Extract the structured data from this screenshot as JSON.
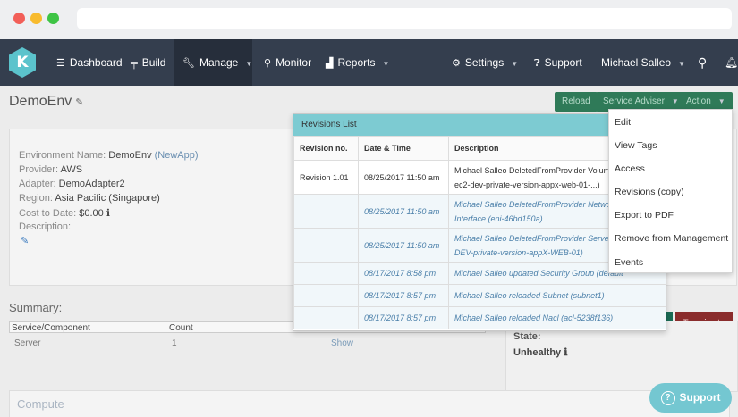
{
  "nav": {
    "logo_letter": "K",
    "items": {
      "dashboard": "Dashboard",
      "build": "Build",
      "manage": "Manage",
      "monitor": "Monitor",
      "reports": "Reports",
      "settings": "Settings",
      "support": "Support",
      "user": "Michael Salleo"
    },
    "accent_color": "#343e4e"
  },
  "page": {
    "title": "DemoEnv",
    "buttons": {
      "reload": "Reload",
      "service_adviser": "Service Adviser",
      "action": "Action"
    }
  },
  "environment": {
    "name_label": "Environment Name:",
    "name_value": "DemoEnv",
    "name_link": "(NewApp)",
    "provider_label": "Provider:",
    "provider_value": "AWS",
    "adapter_label": "Adapter:",
    "adapter_value": "DemoAdapter2",
    "region_label": "Region:",
    "region_value": "Asia Pacific (Singapore)",
    "cost_label": "Cost to Date:",
    "cost_value": "$0.00",
    "description_label": "Description:"
  },
  "summary": {
    "title": "Summary:",
    "headers": {
      "component": "Service/Component",
      "count": "Count"
    },
    "rows": [
      {
        "component": "Server",
        "count": "1",
        "action": "Show"
      }
    ]
  },
  "state": {
    "label": "State:",
    "value": "Unhealthy",
    "terminate": "Terminate"
  },
  "compute": {
    "title": "Compute"
  },
  "revisions": {
    "title": "Revisions List",
    "headers": {
      "revision": "Revision no.",
      "date": "Date & Time",
      "description": "Description"
    },
    "rows": [
      {
        "revision": "Revision 1.01",
        "date": "08/25/2017 11:50 am",
        "desc1": "Michael Salleo DeletedFromProvider Volume (V",
        "desc2": "ec2-dev-private-version-appx-web-01-...)"
      },
      {
        "revision": "",
        "date": "08/25/2017 11:50 am",
        "desc1": "Michael Salleo DeletedFromProvider Network",
        "desc2": "Interface (eni-46bd150a)"
      },
      {
        "revision": "",
        "date": "08/25/2017 11:50 am",
        "desc1": "Michael Salleo DeletedFromProvider Server (EC",
        "desc2": "DEV-private-version-appX-WEB-01)"
      },
      {
        "revision": "",
        "date": "08/17/2017 8:58 pm",
        "desc1": "Michael Salleo updated Security Group (default",
        "desc2": ""
      },
      {
        "revision": "",
        "date": "08/17/2017 8:57 pm",
        "desc1": "Michael Salleo reloaded Subnet (subnet1)",
        "desc2": ""
      },
      {
        "revision": "",
        "date": "08/17/2017 8:57 pm",
        "desc1": "Michael Salleo reloaded Nacl (acl-5238f136)",
        "desc2": ""
      }
    ]
  },
  "action_menu": {
    "items": [
      "Edit",
      "View Tags",
      "Access",
      "Revisions (copy)",
      "Export to PDF",
      "Remove from Management",
      "Events"
    ]
  },
  "support_button": "Support",
  "icons": {
    "dashboard": "menu-icon",
    "build": "build-icon",
    "manage": "wrench-icon",
    "monitor": "search-icon",
    "reports": "bar-chart-icon",
    "settings": "gear-icon",
    "support": "question-icon",
    "search": "search-icon",
    "notifications": "bell-icon"
  }
}
